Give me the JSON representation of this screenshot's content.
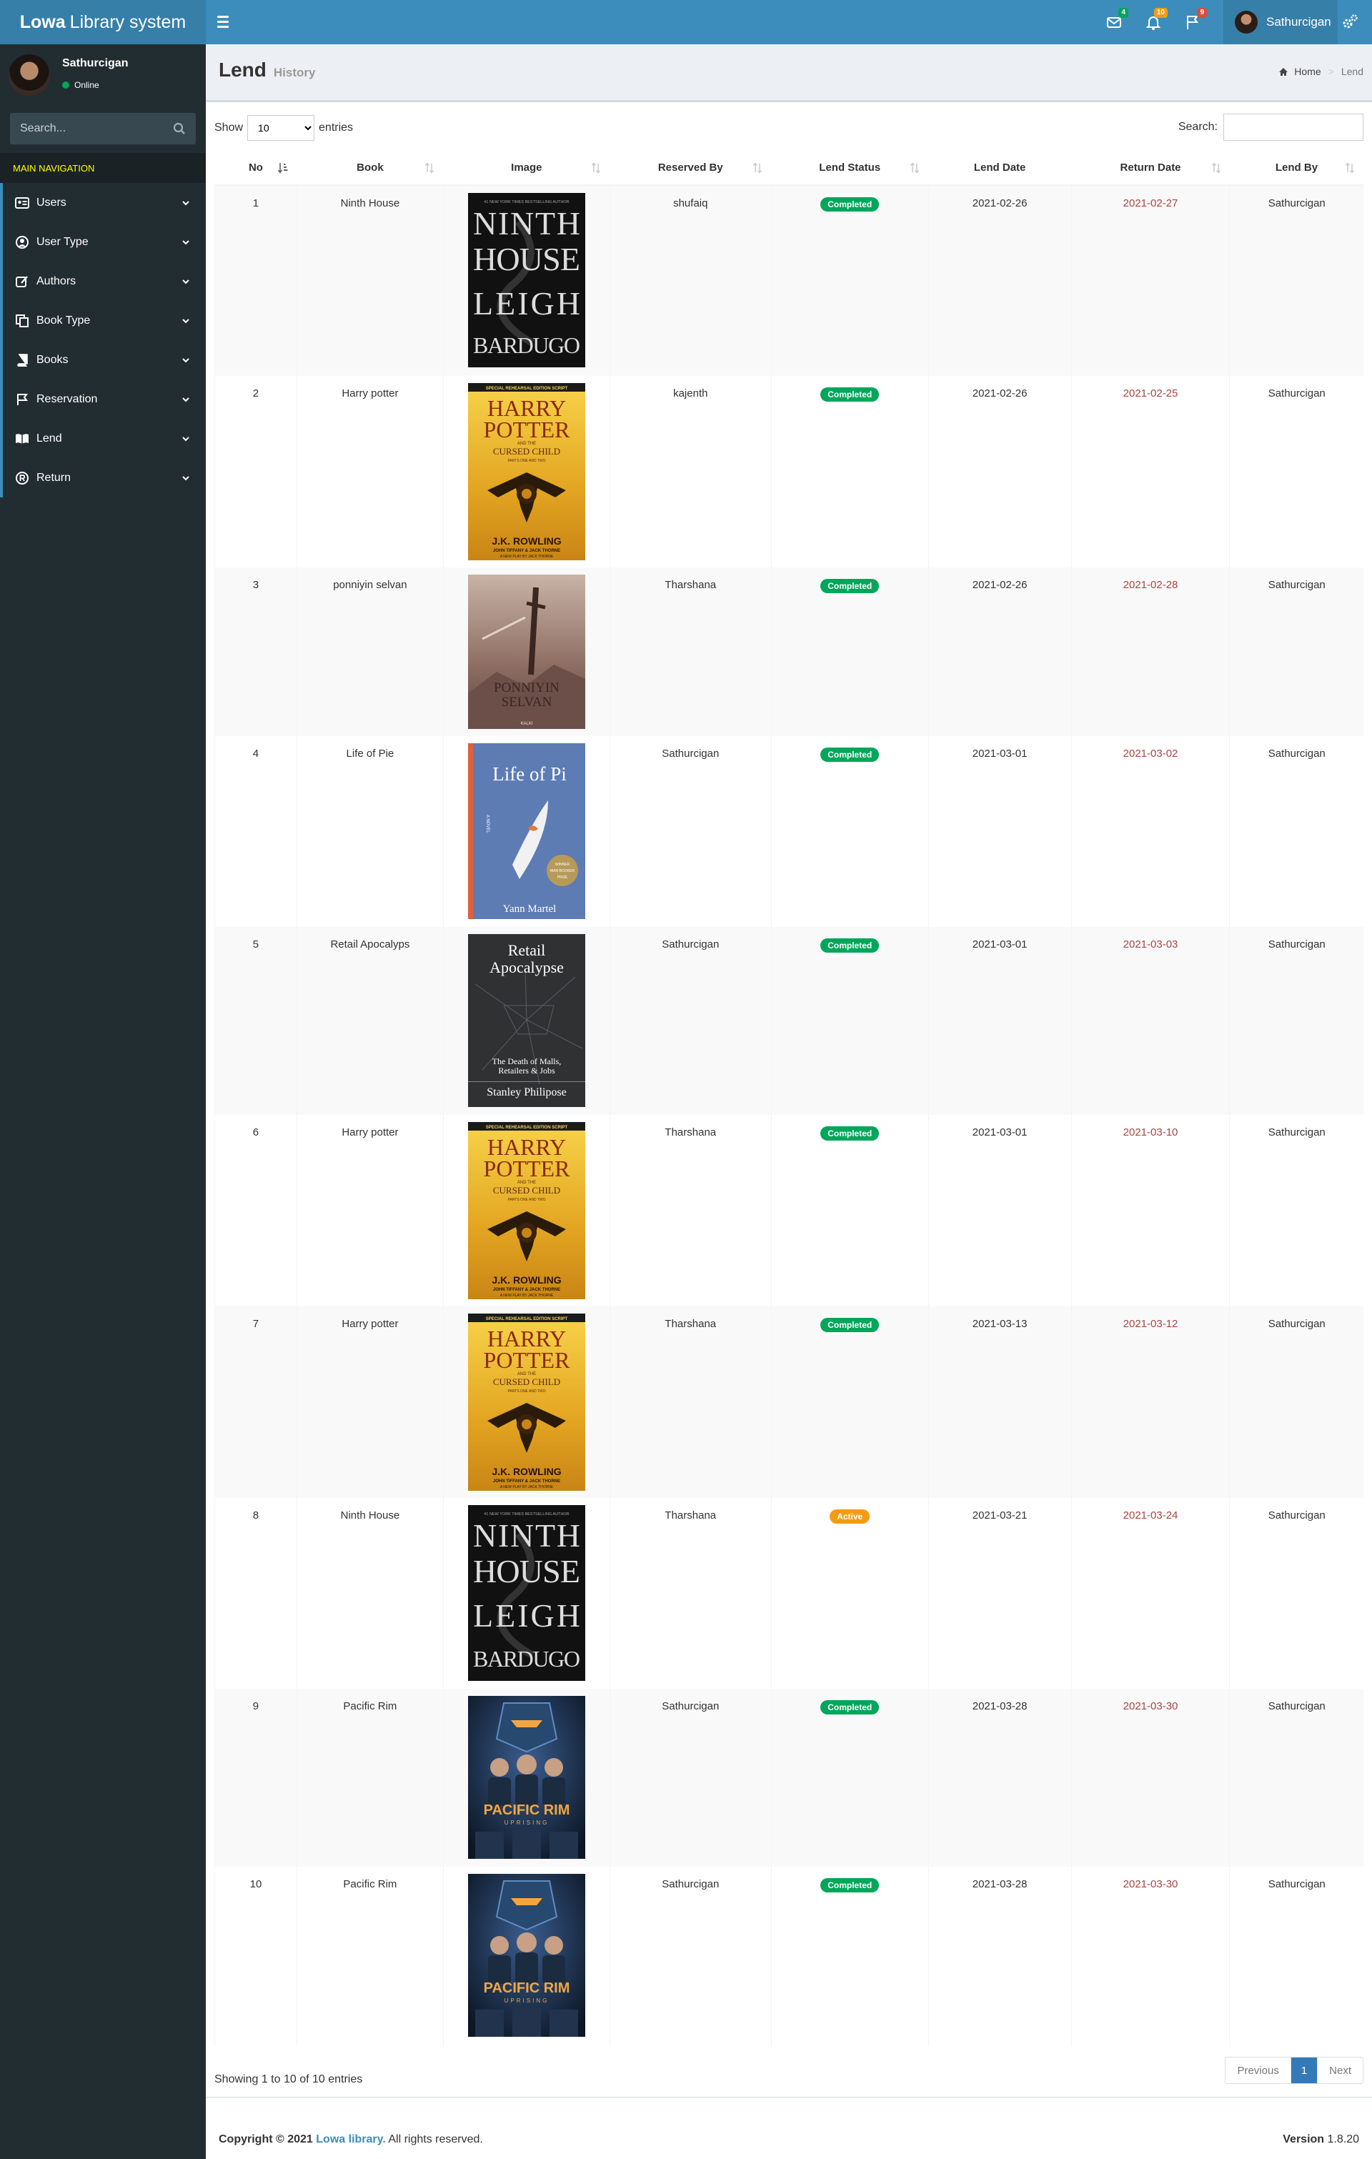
{
  "app": {
    "logo_bold": "Lowa",
    "logo_rest": "Library system"
  },
  "header": {
    "notifications": [
      {
        "icon": "envelope-icon",
        "count": "4",
        "color": "#00a65a"
      },
      {
        "icon": "bell-icon",
        "count": "10",
        "color": "#f39c12"
      },
      {
        "icon": "flag-icon",
        "count": "9",
        "color": "#dd4b39"
      }
    ],
    "user_name": "Sathurcigan"
  },
  "sidebar": {
    "user_name": "Sathurcigan",
    "status": "Online",
    "search_placeholder": "Search...",
    "nav_header": "MAIN NAVIGATION",
    "items": [
      {
        "label": "Users",
        "icon": "id-card-icon"
      },
      {
        "label": "User Type",
        "icon": "user-circle-icon"
      },
      {
        "label": "Authors",
        "icon": "edit-icon"
      },
      {
        "label": "Book Type",
        "icon": "copy-icon"
      },
      {
        "label": "Books",
        "icon": "book-icon"
      },
      {
        "label": "Reservation",
        "icon": "flag-icon"
      },
      {
        "label": "Lend",
        "icon": "open-book-icon"
      },
      {
        "label": "Return",
        "icon": "registered-icon"
      }
    ]
  },
  "page": {
    "title": "Lend",
    "subtitle": "History",
    "breadcrumb": {
      "home": "Home",
      "current": "Lend"
    }
  },
  "table": {
    "show_label": "Show",
    "entries_value": "10",
    "entries_label": "entries",
    "search_label": "Search:",
    "columns": [
      "No",
      "Book",
      "Image",
      "Reserved By",
      "Lend Status",
      "Lend Date",
      "Return Date",
      "Lend By"
    ],
    "rows": [
      {
        "no": "1",
        "book": "Ninth House",
        "cover": "ninth-house",
        "reserved_by": "shufaiq",
        "status": "Completed",
        "lend_date": "2021-02-26",
        "return_date": "2021-02-27",
        "lend_by": "Sathurcigan"
      },
      {
        "no": "2",
        "book": "Harry potter",
        "cover": "harry-potter",
        "reserved_by": "kajenth",
        "status": "Completed",
        "lend_date": "2021-02-26",
        "return_date": "2021-02-25",
        "lend_by": "Sathurcigan"
      },
      {
        "no": "3",
        "book": "ponniyin selvan",
        "cover": "ponniyin-selvan",
        "reserved_by": "Tharshana",
        "status": "Completed",
        "lend_date": "2021-02-26",
        "return_date": "2021-02-28",
        "lend_by": "Sathurcigan"
      },
      {
        "no": "4",
        "book": "Life of Pie",
        "cover": "life-of-pi",
        "reserved_by": "Sathurcigan",
        "status": "Completed",
        "lend_date": "2021-03-01",
        "return_date": "2021-03-02",
        "lend_by": "Sathurcigan"
      },
      {
        "no": "5",
        "book": "Retail Apocalyps",
        "cover": "retail-apocalypse",
        "reserved_by": "Sathurcigan",
        "status": "Completed",
        "lend_date": "2021-03-01",
        "return_date": "2021-03-03",
        "lend_by": "Sathurcigan"
      },
      {
        "no": "6",
        "book": "Harry potter",
        "cover": "harry-potter",
        "reserved_by": "Tharshana",
        "status": "Completed",
        "lend_date": "2021-03-01",
        "return_date": "2021-03-10",
        "lend_by": "Sathurcigan"
      },
      {
        "no": "7",
        "book": "Harry potter",
        "cover": "harry-potter",
        "reserved_by": "Tharshana",
        "status": "Completed",
        "lend_date": "2021-03-13",
        "return_date": "2021-03-12",
        "lend_by": "Sathurcigan"
      },
      {
        "no": "8",
        "book": "Ninth House",
        "cover": "ninth-house",
        "reserved_by": "Tharshana",
        "status": "Active",
        "lend_date": "2021-03-21",
        "return_date": "2021-03-24",
        "lend_by": "Sathurcigan"
      },
      {
        "no": "9",
        "book": "Pacific Rim",
        "cover": "pacific-rim",
        "reserved_by": "Sathurcigan",
        "status": "Completed",
        "lend_date": "2021-03-28",
        "return_date": "2021-03-30",
        "lend_by": "Sathurcigan"
      },
      {
        "no": "10",
        "book": "Pacific Rim",
        "cover": "pacific-rim",
        "reserved_by": "Sathurcigan",
        "status": "Completed",
        "lend_date": "2021-03-28",
        "return_date": "2021-03-30",
        "lend_by": "Sathurcigan"
      }
    ],
    "info": "Showing 1 to 10 of 10 entries",
    "pagination": {
      "previous": "Previous",
      "current": "1",
      "next": "Next"
    }
  },
  "covers": {
    "ninth-house": {
      "lines": [
        "NINTH",
        "HOUSE",
        "LEIGH",
        "BARDUGO"
      ],
      "tagline": "#1 NEW YORK TIMES BESTSELLING AUTHOR"
    },
    "harry-potter": {
      "top": "SPECIAL REHEARSAL EDITION SCRIPT",
      "title1": "HARRY",
      "title2": "POTTER",
      "sub1": "AND THE",
      "sub2": "CURSED CHILD",
      "sub3": "PARTS ONE AND TWO",
      "author": "J.K. ROWLING",
      "coauthors": "JOHN TIFFANY & JACK THORNE",
      "credit": "A NEW PLAY BY JACK THORNE"
    },
    "ponniyin-selvan": {
      "title1": "PONNIYIN",
      "title2": "SELVAN",
      "author": "KALKI"
    },
    "life-of-pi": {
      "title": "Life of Pi",
      "genre": "A NOVEL",
      "author": "Yann Martel",
      "seal1": "WINNER",
      "seal2": "MAN BOOKER",
      "seal3": "PRIZE"
    },
    "retail-apocalypse": {
      "title1": "Retail",
      "title2": "Apocalypse",
      "subtitle1": "The Death of Malls,",
      "subtitle2": "Retailers & Jobs",
      "author": "Stanley Philipose"
    },
    "pacific-rim": {
      "title1": "PACIFIC RIM",
      "title2": "UPRISING"
    }
  },
  "footer": {
    "copy_prefix": "Copyright © 2021",
    "link": "Lowa library.",
    "copy_suffix": "All rights reserved.",
    "version_label": "Version",
    "version": "1.8.20"
  }
}
